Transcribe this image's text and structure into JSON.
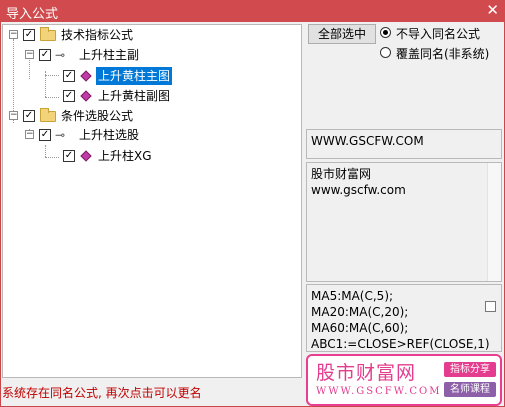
{
  "window": {
    "title": "导入公式",
    "close_glyph": "✕"
  },
  "tree": {
    "nodes": [
      {
        "label": "技术指标公式",
        "icon": "folder-icon",
        "checked": true
      },
      {
        "label": "上升柱主副",
        "icon": "key-icon",
        "checked": true
      },
      {
        "label": "上升黄柱主图",
        "icon": "formula-gem-icon",
        "checked": true,
        "selected": true
      },
      {
        "label": "上升黄柱副图",
        "icon": "formula-gem-icon",
        "checked": true
      },
      {
        "label": "条件选股公式",
        "icon": "folder-icon",
        "checked": true
      },
      {
        "label": "上升柱选股",
        "icon": "key-icon",
        "checked": true
      },
      {
        "label": "上升柱XG",
        "icon": "formula-gem-icon",
        "checked": true
      }
    ],
    "collapse_glyph": "−",
    "check_glyph": "✓"
  },
  "controls": {
    "select_all": "全部选中",
    "radio_options": [
      {
        "label": "不导入同名公式",
        "selected": true
      },
      {
        "label": "覆盖同名(非系统)",
        "selected": false
      }
    ]
  },
  "info": {
    "url_field": "WWW.GSCFW.COM",
    "description": [
      "股市财富网",
      "www.gscfw.com"
    ],
    "code": [
      "MA5:MA(C,5);",
      "MA20:MA(C,20);",
      "MA60:MA(C,60);",
      "ABC1:=CLOSE>REF(CLOSE,1)"
    ]
  },
  "status": "系统存在同名公式, 再次点击可以更名",
  "watermark": {
    "brand": "股市财富网",
    "url": "WWW.GSCFW.COM",
    "tag1": "指标分享",
    "tag2": "名师课程"
  },
  "colors": {
    "titlebar": "#d04a4e",
    "selection": "#0078d7",
    "status_text": "#c00000",
    "watermark": "#e43c8e",
    "tag1_bg": "#e43c8e",
    "tag2_bg": "#8c5fa8"
  }
}
